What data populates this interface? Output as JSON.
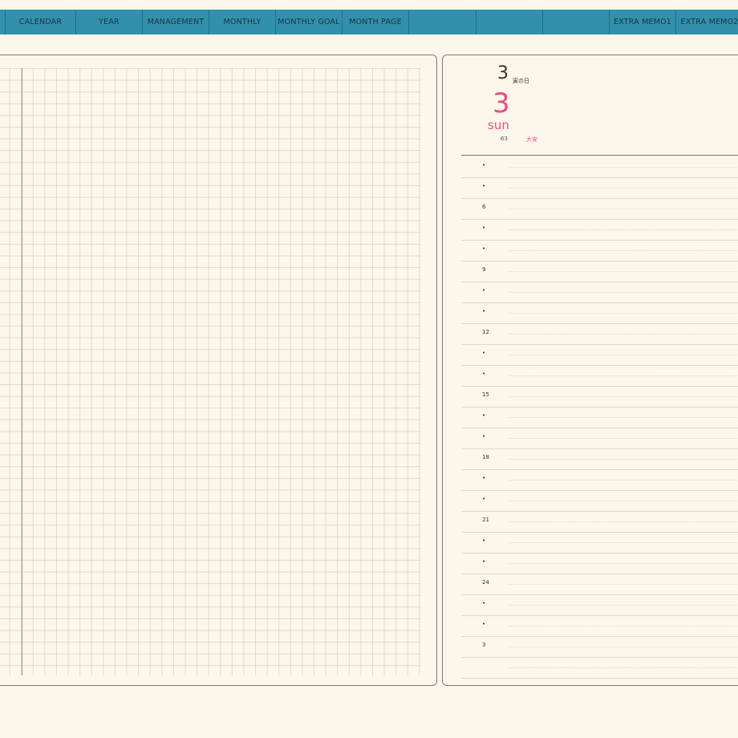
{
  "tabs": [
    {
      "label": "CALENDAR"
    },
    {
      "label": "YEAR"
    },
    {
      "label": "MANAGEMENT"
    },
    {
      "label": "MONTHLY"
    },
    {
      "label": "MONTHLY GOAL"
    },
    {
      "label": "MONTH PAGE"
    },
    {
      "label": ""
    },
    {
      "label": ""
    },
    {
      "label": ""
    },
    {
      "label": "EXTRA MEMO1"
    },
    {
      "label": "EXTRA MEMO2"
    }
  ],
  "day": {
    "small_date": "3",
    "rokuyo": "寅の日",
    "big_date": "3",
    "weekday": "sun",
    "day_number": "63",
    "event": "大安"
  },
  "schedule": {
    "hours": [
      "•",
      "•",
      "6",
      "•",
      "•",
      "9",
      "•",
      "•",
      "12",
      "•",
      "•",
      "15",
      "•",
      "•",
      "18",
      "•",
      "•",
      "21",
      "•",
      "•",
      "24",
      "•",
      "•",
      "3",
      ""
    ]
  },
  "colors": {
    "tab_bar": "#3390ad",
    "page_background": "#fdf6ea",
    "accent_pink": "#e44f84"
  }
}
